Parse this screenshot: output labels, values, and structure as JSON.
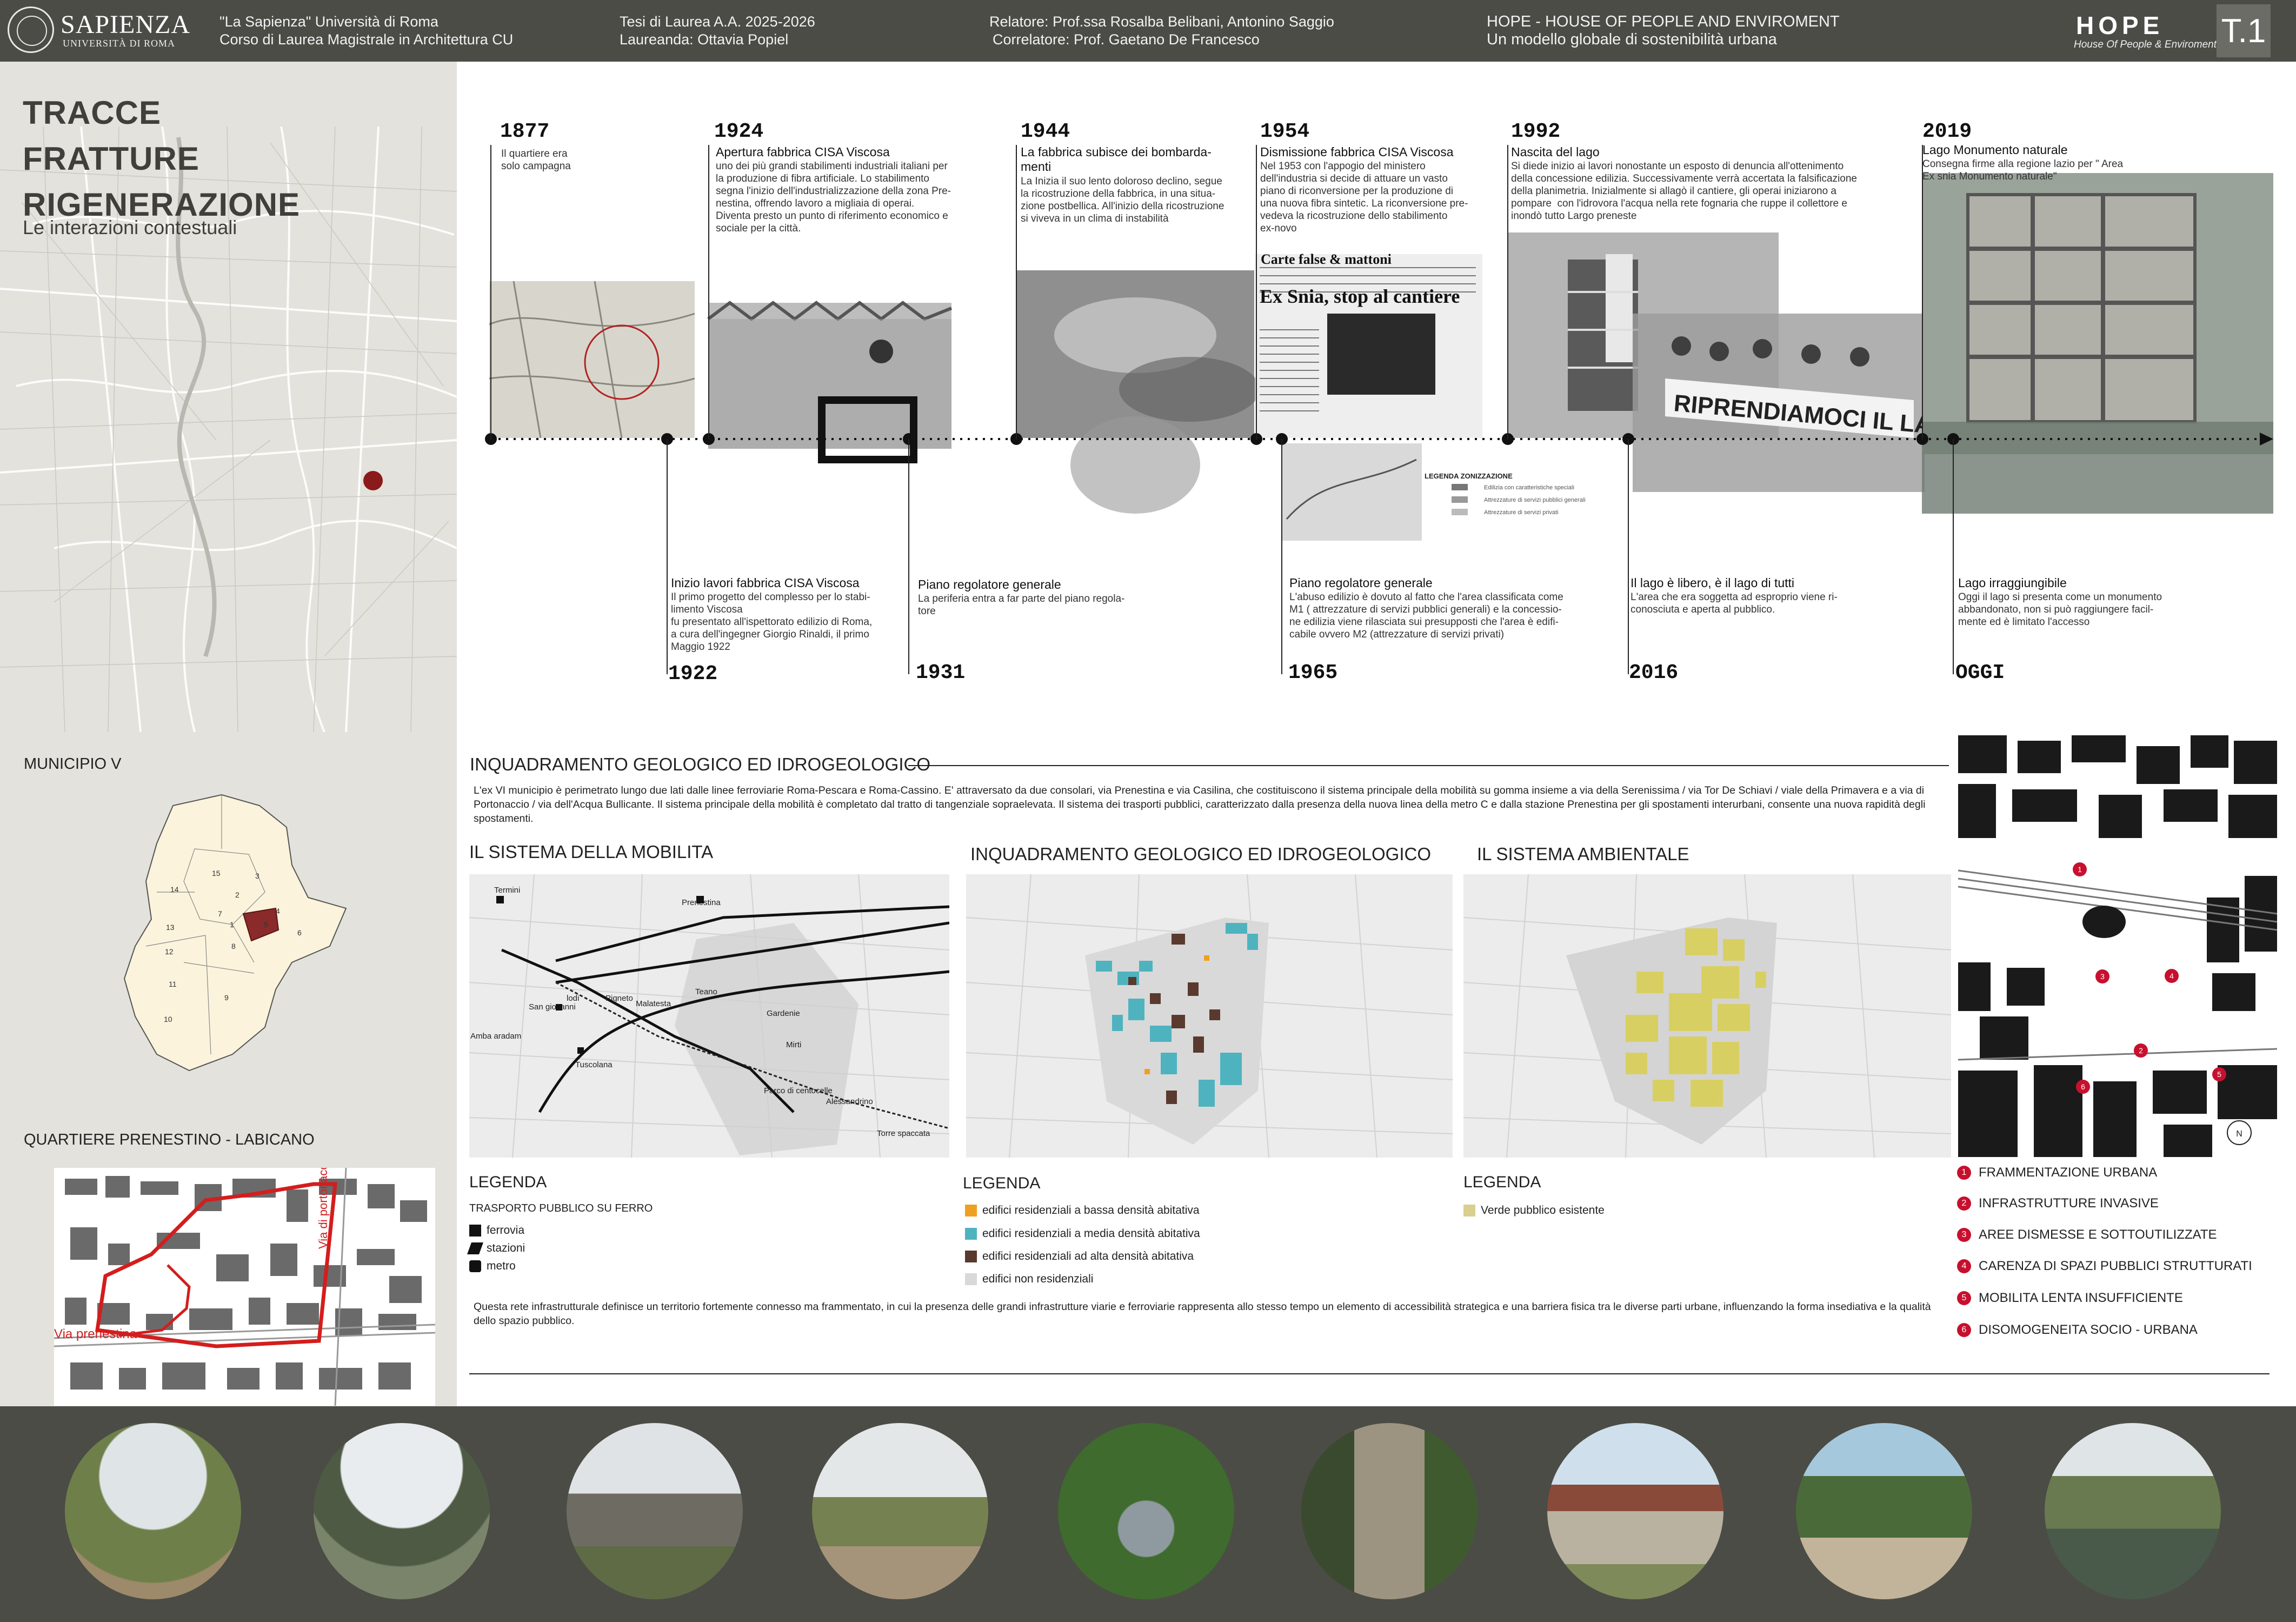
{
  "header": {
    "university_logo_name": "SAPIENZA",
    "university_logo_sub": "UNIVERSITÀ DI ROMA",
    "university": "\"La Sapienza\" Università di Roma",
    "course": "Corso di Laurea Magistrale in Architettura CU",
    "thesis": "Tesi di Laurea A.A. 2025-2026",
    "student": "Laureanda: Ottavia Popiel",
    "supervisor": "Relatore: Prof.ssa Rosalba Belibani, Antonino Saggio",
    "co_supervisor": "Correlatore: Prof. Gaetano De Francesco",
    "project_title": "HOPE - HOUSE OF PEOPLE AND ENVIROMENT",
    "project_subtitle": "Un modello globale di sostenibilità urbana",
    "logo_text": "HOPE",
    "logo_tagline": "House Of People & Enviroment",
    "table_number": "T.1"
  },
  "left_panel": {
    "title_line1": "TRACCE",
    "title_line2": "FRATTURE",
    "title_line3": "RIGENERAZIONE",
    "subtitle": "Le interazioni contestuali",
    "municipio_title": "MUNICIPIO V",
    "municipio_numbers": [
      "15",
      "3",
      "14",
      "2",
      "4",
      "13",
      "1",
      "12",
      "7",
      "5",
      "8",
      "6",
      "11",
      "9",
      "10"
    ],
    "quartiere_title": "QUARTIERE PRENESTINO - LABICANO",
    "street_prenestina": "Via prenestina",
    "street_portonaccio": "Via di portonaccio"
  },
  "timeline": {
    "top": [
      {
        "year": "1877",
        "title": "",
        "text": "Il quartiere era\nsolo campagna"
      },
      {
        "year": "1924",
        "title": "Apertura fabbrica CISA Viscosa",
        "text": "uno dei più grandi stabilimenti industriali italiani per\nla produzione di fibra artificiale. Lo stabilimento\nsegna l'inizio dell'industrializzazione della zona Pre-\nnestina, offrendo lavoro a migliaia di operai.\nDiventa presto un punto di riferimento economico e\nsociale per la città."
      },
      {
        "year": "1944",
        "title": "La fabbrica subisce dei bombarda-\nmenti",
        "text": "La Inizia il suo lento doloroso declino, segue\nla ricostruzione della fabbrica, in una situa-\nzione postbellica. All'inizio della ricostruzione\nsi viveva in un clima di instabilità"
      },
      {
        "year": "1954",
        "title": "Dismissione fabbrica CISA Viscosa",
        "text": "Nel 1953 con l'appogio del ministero\ndell'industria si decide di attuare un vasto\npiano di riconversione per la produzione di\nuna nuova fibra sintetic. La riconversione pre-\nvedeva la ricostruzione dello stabilimento\nex-novo"
      },
      {
        "year": "1992",
        "title": "Nascita del lago",
        "text": "Si diede inizio ai lavori nonostante un esposto di denuncia all'ottenimento\ndella concessione edilizia. Successivamente verrà accertata la falsificazione\ndella planimetria. Inizialmente si allagò il cantiere, gli operai iniziarono a\npompare  con l'idrovora l'acqua nella rete fognaria che ruppe il collettore e\ninondò tutto Largo preneste"
      },
      {
        "year": "2019",
        "title": "Lago Monumento naturale",
        "text": "Consegna firme alla regione lazio per \" Area\nEx snia Monumento naturale\""
      }
    ],
    "bottom": [
      {
        "year": "1922",
        "title": "Inizio lavori fabbrica CISA Viscosa",
        "text": "Il primo progetto del complesso per lo stabi-\nlimento Viscosa\nfu presentato all'ispettorato edilizio di Roma,\na cura dell'ingegner Giorgio Rinaldi, il primo\nMaggio 1922"
      },
      {
        "year": "1931",
        "title": "Piano regolatore generale",
        "text": "La periferia entra a far parte del piano regola-\ntore"
      },
      {
        "year": "1965",
        "title": "Piano regolatore generale",
        "text": "L'abuso edilizio è dovuto al fatto che l'area classificata come\nM1 ( attrezzature di servizi pubblici generali) e la concessio-\nne edilizia viene rilasciata sui presupposti che l'area è edifi-\ncabile ovvero M2 (attrezzature di servizi privati)"
      },
      {
        "year": "2016",
        "title": "Il lago è libero, è il lago di tutti",
        "text": "L'area che era soggetta ad esproprio viene ri-\nconosciuta e aperta al pubblico."
      },
      {
        "year": "OGGI",
        "title": "Lago irraggiungibile",
        "text": "Oggi il lago si presenta come un monumento\nabbandonato, non si può raggiungere facil-\nmente ed è limitato l'accesso"
      }
    ],
    "newspaper_headline": "Ex Snia, stop al cantiere",
    "newspaper_kicker": "Carte false & mattoni",
    "banner_text": "RIPRENDIAMOCI IL LAGO",
    "legend_zoning_title": "LEGENDA ZONIZZAZIONE",
    "legend_zoning_items": [
      "Edilizia con caratteristiche speciali",
      "Attrezzature di servizi pubblici generali",
      "Attrezzature di servizi privati"
    ]
  },
  "middle": {
    "section_title": "INQUADRAMENTO GEOLOGICO ED IDROGEOLOGICO",
    "intro_text": "L'ex VI municipio è perimetrato lungo due lati dalle linee ferroviarie Roma-Pescara e Roma-Cassino. E' attraversato da due consolari, via Prenestina e via Casilina, che costituiscono il sistema principale della mobilità su gomma insieme a via della Serenissima / via Tor De Schiavi / viale della Primavera e a via di Portonaccio / via dell'Acqua Bullicante. Il sistema principale della mobilità è completato dal tratto di tangenziale sopraelevata. Il sistema dei trasporti pubblici, caratterizzato dalla presenza della nuova linea della metro C e dalla stazione Prenestina per gli spostamenti interurbani, consente una nuova rapidità degli spostamenti.",
    "map1_title": "IL SISTEMA DELLA MOBILITA",
    "map2_title": "INQUADRAMENTO GEOLOGICO ED IDROGEOLOGICO",
    "map3_title": "IL SISTEMA AMBIENTALE",
    "map1_labels": [
      "Termini",
      "Prenestina",
      "San giovanni",
      "lodi",
      "Pigneto",
      "Malatesta",
      "Teano",
      "Gardenie",
      "Mirti",
      "Amba aradam",
      "Tuscolana",
      "Parco di centocelle",
      "Alessandrino",
      "Torre spaccata"
    ],
    "legend_label": "LEGENDA",
    "legend1_sub": "TRASPORTO PUBBLICO SU FERRO",
    "legend1_items": [
      "ferrovia",
      "stazioni",
      "metro"
    ],
    "legend2_items": [
      "edifici residenziali a bassa densità abitativa",
      "edifici residenziali a media densità abitativa",
      "edifici residenziali ad alta densità abitativa",
      "edifici non residenziali"
    ],
    "legend3_items": [
      "Verde pubblico esistente"
    ],
    "bottom_text": "Questa rete infrastrutturale definisce un territorio fortemente connesso ma frammentato, in cui la presenza delle grandi infrastrutture viarie e ferroviarie rappresenta allo stesso tempo un elemento di accessibilità strategica e una barriera fisica tra le diverse parti urbane, influenzando la forma insediativa e la qualità dello spazio pubblico."
  },
  "criticality": {
    "items": [
      {
        "num": "1",
        "label": "FRAMMENTAZIONE URBANA"
      },
      {
        "num": "2",
        "label": "INFRASTRUTTURE INVASIVE"
      },
      {
        "num": "3",
        "label": "AREE DISMESSE E SOTTOUTILIZZATE"
      },
      {
        "num": "4",
        "label": "CARENZA DI SPAZI PUBBLICI STRUTTURATI"
      },
      {
        "num": "5",
        "label": "MOBILITA LENTA INSUFFICIENTE"
      },
      {
        "num": "6",
        "label": "DISOMOGENEITA SOCIO - URBANA"
      }
    ],
    "map_markers": [
      "1",
      "2",
      "3",
      "4",
      "5",
      "6"
    ],
    "north": "N"
  },
  "colors": {
    "header_bg": "#4b4c46",
    "left_bg": "#e3e2dc",
    "accent_red": "#c8102e",
    "low_density": "#f0a020",
    "mid_density": "#4fb3bf",
    "high_density": "#5a3a2e",
    "non_residential": "#d9d9d9",
    "green": "#d9cf8f"
  },
  "photos": [
    "photo-field-path",
    "photo-ruin-building",
    "photo-ruin-facade",
    "photo-path-field",
    "photo-lake-trees",
    "photo-bullicante-sign",
    "photo-pergola",
    "photo-pine-trees",
    "photo-lake-ruin"
  ]
}
